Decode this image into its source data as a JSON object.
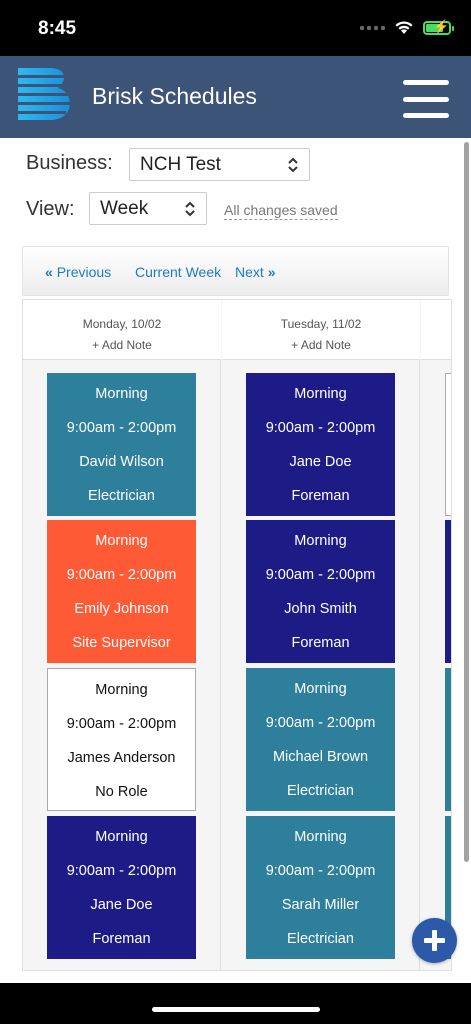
{
  "status_bar": {
    "time": "8:45",
    "icons": [
      "cellular-icon",
      "wifi-icon",
      "battery-charging-icon"
    ]
  },
  "header": {
    "title": "Brisk Schedules",
    "logo": "brisk-logo",
    "menu_icon": "hamburger-menu-icon",
    "background": "#3d5479"
  },
  "form": {
    "business_label": "Business:",
    "business_value": "NCH Test",
    "view_label": "View:",
    "view_value": "Week",
    "save_status": "All changes saved"
  },
  "nav": {
    "previous": "Previous",
    "current_week": "Current Week",
    "next": "Next"
  },
  "days": [
    {
      "name": "Monday, 10/02",
      "add_note": "+ Add Note",
      "shifts": [
        {
          "period": "Morning",
          "time": "9:00am - 2:00pm",
          "person": "David Wilson",
          "role": "Electrician",
          "color": "#2e7f9c"
        },
        {
          "period": "Morning",
          "time": "9:00am - 2:00pm",
          "person": "Emily Johnson",
          "role": "Site Supervisor",
          "color": "#ff5a36"
        },
        {
          "period": "Morning",
          "time": "9:00am - 2:00pm",
          "person": "James Anderson",
          "role": "No Role",
          "color": "#ffffff"
        },
        {
          "period": "Morning",
          "time": "9:00am - 2:00pm",
          "person": "Jane Doe",
          "role": "Foreman",
          "color": "#1d1c87"
        }
      ]
    },
    {
      "name": "Tuesday, 11/02",
      "add_note": "+ Add Note",
      "shifts": [
        {
          "period": "Morning",
          "time": "9:00am - 2:00pm",
          "person": "Jane Doe",
          "role": "Foreman",
          "color": "#1d1c87"
        },
        {
          "period": "Morning",
          "time": "9:00am - 2:00pm",
          "person": "John Smith",
          "role": "Foreman",
          "color": "#1d1c87"
        },
        {
          "period": "Morning",
          "time": "9:00am - 2:00pm",
          "person": "Michael Brown",
          "role": "Electrician",
          "color": "#2e7f9c"
        },
        {
          "period": "Morning",
          "time": "9:00am - 2:00pm",
          "person": "Sarah Miller",
          "role": "Electrician",
          "color": "#2e7f9c"
        }
      ]
    }
  ],
  "fab_icon": "add-plus-icon"
}
